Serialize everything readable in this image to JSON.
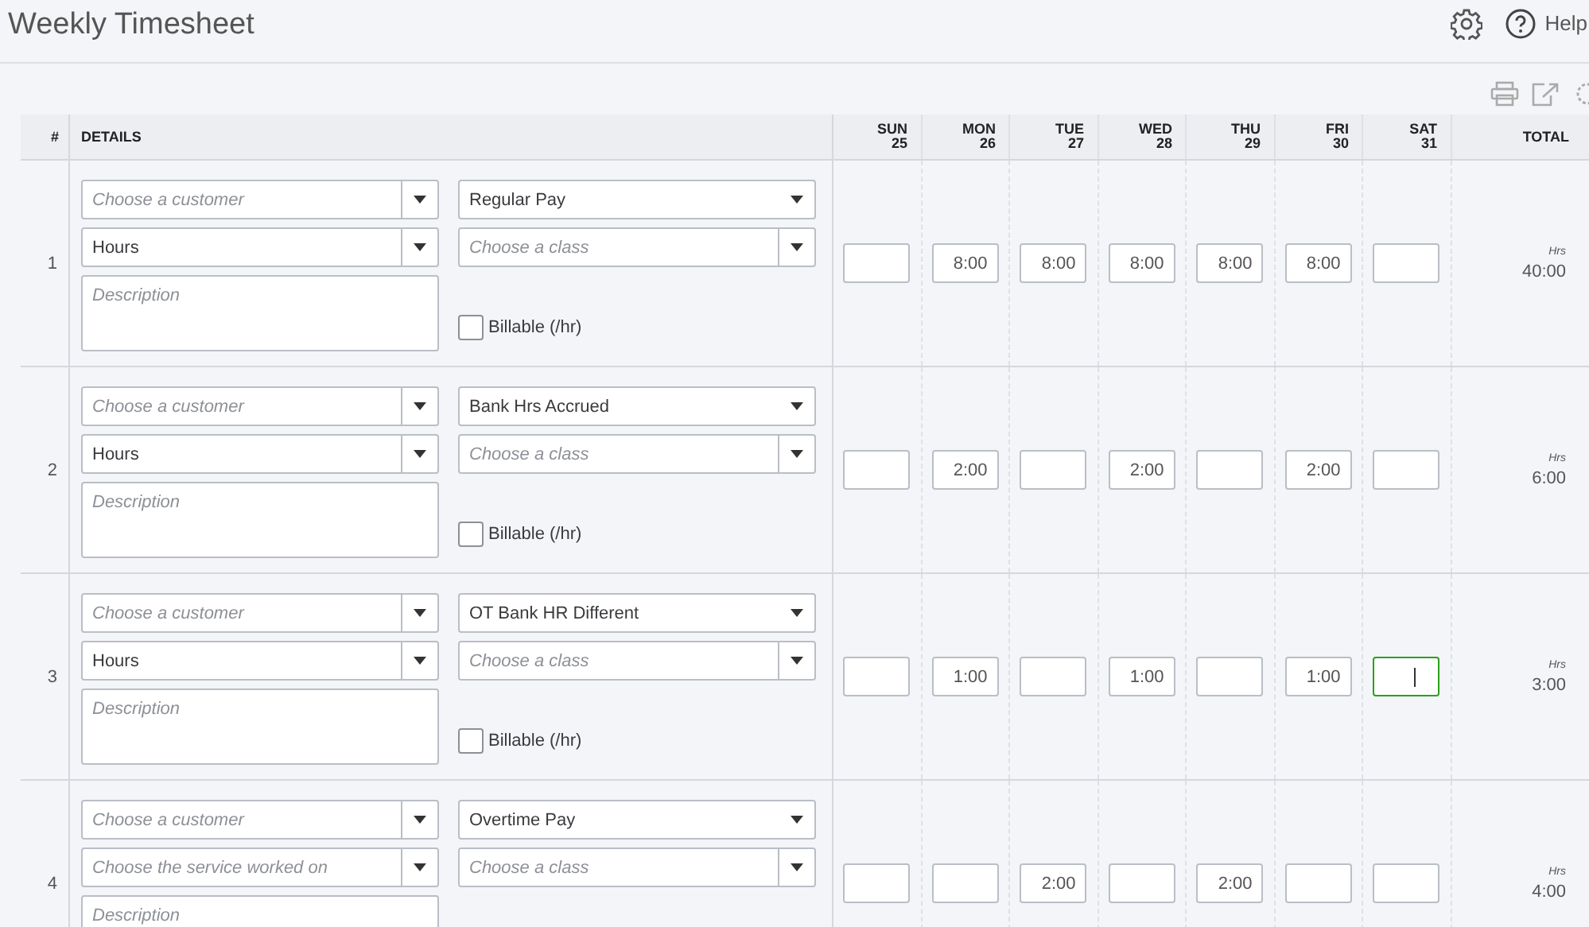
{
  "header": {
    "title": "Weekly Timesheet",
    "help_label": "Help"
  },
  "table": {
    "number_heading": "#",
    "details_heading": "DETAILS",
    "total_heading": "TOTAL",
    "days": [
      {
        "day": "SUN",
        "date": "25"
      },
      {
        "day": "MON",
        "date": "26"
      },
      {
        "day": "TUE",
        "date": "27"
      },
      {
        "day": "WED",
        "date": "28"
      },
      {
        "day": "THU",
        "date": "29"
      },
      {
        "day": "FRI",
        "date": "30"
      },
      {
        "day": "SAT",
        "date": "31"
      }
    ],
    "rows": [
      {
        "number": "1",
        "customer": {
          "placeholder": "Choose a customer"
        },
        "service": {
          "value": "Hours"
        },
        "pay_type": {
          "value": "Regular Pay"
        },
        "class": {
          "placeholder": "Choose a class"
        },
        "description": {
          "placeholder": "Description"
        },
        "billable": {
          "label": "Billable (/hr)",
          "checked": false
        },
        "hours": [
          {
            "focused": false
          },
          {
            "value": "8:00",
            "focused": false
          },
          {
            "value": "8:00",
            "focused": false
          },
          {
            "value": "8:00",
            "focused": false
          },
          {
            "value": "8:00",
            "focused": false
          },
          {
            "value": "8:00",
            "focused": false
          },
          {
            "focused": false
          }
        ],
        "total_unit": "Hrs",
        "total": "40:00"
      },
      {
        "number": "2",
        "customer": {
          "placeholder": "Choose a customer"
        },
        "service": {
          "value": "Hours"
        },
        "pay_type": {
          "value": "Bank Hrs Accrued"
        },
        "class": {
          "placeholder": "Choose a class"
        },
        "description": {
          "placeholder": "Description"
        },
        "billable": {
          "label": "Billable (/hr)",
          "checked": false
        },
        "hours": [
          {
            "focused": false
          },
          {
            "value": "2:00",
            "focused": false
          },
          {
            "focused": false
          },
          {
            "value": "2:00",
            "focused": false
          },
          {
            "focused": false
          },
          {
            "value": "2:00",
            "focused": false
          },
          {
            "focused": false
          }
        ],
        "total_unit": "Hrs",
        "total": "6:00"
      },
      {
        "number": "3",
        "customer": {
          "placeholder": "Choose a customer"
        },
        "service": {
          "value": "Hours"
        },
        "pay_type": {
          "value": "OT Bank HR Different"
        },
        "class": {
          "placeholder": "Choose a class"
        },
        "description": {
          "placeholder": "Description"
        },
        "billable": {
          "label": "Billable (/hr)",
          "checked": false
        },
        "hours": [
          {
            "focused": false
          },
          {
            "value": "1:00",
            "focused": false
          },
          {
            "focused": false
          },
          {
            "value": "1:00",
            "focused": false
          },
          {
            "focused": false
          },
          {
            "value": "1:00",
            "focused": false
          },
          {
            "focused": true
          }
        ],
        "total_unit": "Hrs",
        "total": "3:00"
      },
      {
        "number": "4",
        "customer": {
          "placeholder": "Choose a customer"
        },
        "service": {
          "placeholder": "Choose the service worked on"
        },
        "pay_type": {
          "value": "Overtime Pay"
        },
        "class": {
          "placeholder": "Choose a class"
        },
        "description": {
          "placeholder": "Description"
        },
        "hours": [
          {
            "focused": false
          },
          {
            "focused": false
          },
          {
            "value": "2:00",
            "focused": false
          },
          {
            "focused": false
          },
          {
            "value": "2:00",
            "focused": false
          },
          {
            "focused": false
          },
          {
            "focused": false
          }
        ],
        "total_unit": "Hrs",
        "total": "4:00"
      }
    ]
  }
}
